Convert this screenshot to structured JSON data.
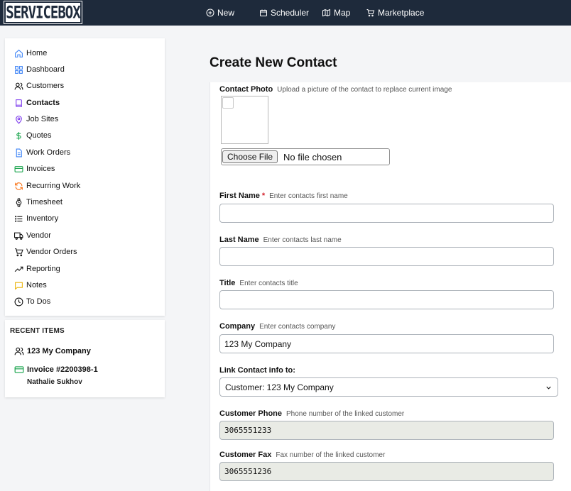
{
  "brand": {
    "logo_text": "SERVICEBOX"
  },
  "topnav": {
    "new": "New",
    "scheduler": "Scheduler",
    "map": "Map",
    "marketplace": "Marketplace"
  },
  "sidebar": {
    "items": [
      {
        "label": "Home",
        "icon": "home-icon",
        "color": "#3b82f6"
      },
      {
        "label": "Dashboard",
        "icon": "dashboard-icon",
        "color": "#3b82f6"
      },
      {
        "label": "Customers",
        "icon": "users-icon",
        "color": "#111111"
      },
      {
        "label": "Contacts",
        "icon": "book-icon",
        "color": "#7c3aed"
      },
      {
        "label": "Job Sites",
        "icon": "map-pin-icon",
        "color": "#7c3aed"
      },
      {
        "label": "Quotes",
        "icon": "dollar-icon",
        "color": "#16a34a"
      },
      {
        "label": "Work Orders",
        "icon": "document-icon",
        "color": "#3b82f6"
      },
      {
        "label": "Invoices",
        "icon": "credit-card-icon",
        "color": "#16a34a"
      },
      {
        "label": "Recurring Work",
        "icon": "refresh-icon",
        "color": "#f97316"
      },
      {
        "label": "Timesheet",
        "icon": "watch-icon",
        "color": "#111111"
      },
      {
        "label": "Inventory",
        "icon": "list-icon",
        "color": "#111111"
      },
      {
        "label": "Vendor",
        "icon": "truck-icon",
        "color": "#111111"
      },
      {
        "label": "Vendor Orders",
        "icon": "cart-icon",
        "color": "#111111"
      },
      {
        "label": "Reporting",
        "icon": "trending-up-icon",
        "color": "#111111"
      },
      {
        "label": "Notes",
        "icon": "message-icon",
        "color": "#eab308"
      },
      {
        "label": "To Dos",
        "icon": "clock-icon",
        "color": "#111111"
      }
    ]
  },
  "recent": {
    "title": "RECENT ITEMS",
    "items": [
      {
        "label": "123 My Company",
        "icon": "users-icon"
      },
      {
        "label": "Invoice #2200398-1",
        "sub": "Nathalie Sukhov",
        "icon": "credit-card-icon"
      }
    ]
  },
  "form": {
    "title": "Create New Contact",
    "photo": {
      "label": "Contact Photo",
      "hint": "Upload a picture of the contact to replace current image",
      "button": "Choose File",
      "file_status": "No file chosen"
    },
    "first_name": {
      "label": "First Name",
      "required_mark": "*",
      "hint": "Enter contacts first name",
      "value": ""
    },
    "last_name": {
      "label": "Last Name",
      "hint": "Enter contacts last name",
      "value": ""
    },
    "title_field": {
      "label": "Title",
      "hint": "Enter contacts title",
      "value": ""
    },
    "company": {
      "label": "Company",
      "hint": "Enter contacts company",
      "value": "123 My Company"
    },
    "link": {
      "label": "Link Contact info to:",
      "selected": "Customer: 123 My Company"
    },
    "phone": {
      "label": "Customer Phone",
      "hint": "Phone number of the linked customer",
      "value": "3065551233"
    },
    "fax": {
      "label": "Customer Fax",
      "hint": "Fax number of the linked customer",
      "value": "3065551236"
    }
  }
}
